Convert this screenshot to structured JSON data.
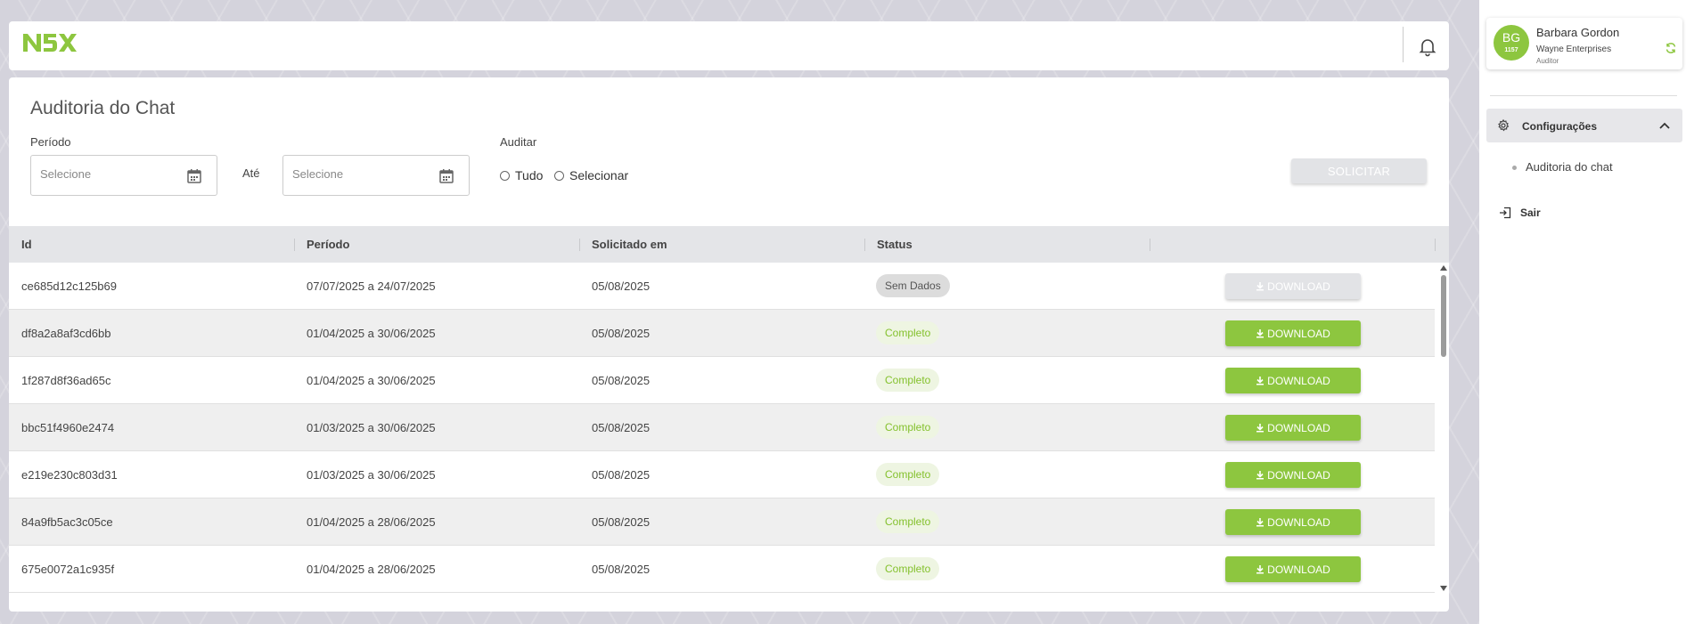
{
  "brand": {
    "logo_text": "N5X",
    "accent": "#8dc63f"
  },
  "header": {
    "bell_icon": "bell-icon"
  },
  "page": {
    "title": "Auditoria do Chat",
    "periodo_label": "Período",
    "ate_label": "Até",
    "auditar_label": "Auditar",
    "start_placeholder": "Selecione",
    "end_placeholder": "Selecione",
    "radio_all": "Tudo",
    "radio_select": "Selecionar",
    "solicitar_label": "SOLICITAR"
  },
  "table": {
    "columns": [
      "Id",
      "Período",
      "Solicitado em",
      "Status",
      ""
    ],
    "download_label": "DOWNLOAD",
    "rows": [
      {
        "id": "ce685d12c125b69",
        "periodo": "07/07/2025 a 24/07/2025",
        "solicitado": "05/08/2025",
        "status": "Sem Dados",
        "download_enabled": false
      },
      {
        "id": "df8a2a8af3cd6bb",
        "periodo": "01/04/2025 a 30/06/2025",
        "solicitado": "05/08/2025",
        "status": "Completo",
        "download_enabled": true
      },
      {
        "id": "1f287d8f36ad65c",
        "periodo": "01/04/2025 a 30/06/2025",
        "solicitado": "05/08/2025",
        "status": "Completo",
        "download_enabled": true
      },
      {
        "id": "bbc51f4960e2474",
        "periodo": "01/03/2025 a 30/06/2025",
        "solicitado": "05/08/2025",
        "status": "Completo",
        "download_enabled": true
      },
      {
        "id": "e219e230c803d31",
        "periodo": "01/03/2025 a 30/06/2025",
        "solicitado": "05/08/2025",
        "status": "Completo",
        "download_enabled": true
      },
      {
        "id": "84a9fb5ac3c05ce",
        "periodo": "01/04/2025 a 28/06/2025",
        "solicitado": "05/08/2025",
        "status": "Completo",
        "download_enabled": true
      },
      {
        "id": "675e0072a1c935f",
        "periodo": "01/04/2025 a 28/06/2025",
        "solicitado": "05/08/2025",
        "status": "Completo",
        "download_enabled": true
      }
    ]
  },
  "user": {
    "initials": "BG",
    "badge_number": "1157",
    "name": "Barbara Gordon",
    "company": "Wayne Enterprises",
    "role": "Auditor"
  },
  "sidebar": {
    "config_label": "Configurações",
    "sub_items": [
      "Auditoria do chat"
    ],
    "exit_label": "Sair"
  }
}
